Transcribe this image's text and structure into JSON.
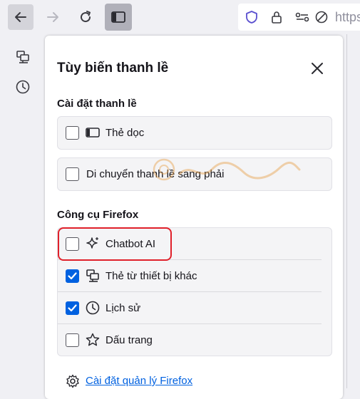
{
  "toolbar": {
    "back_icon": "arrow-left-icon",
    "forward_icon": "arrow-right-icon",
    "reload_icon": "reload-icon",
    "sidebar_icon": "sidebar-icon",
    "url_text": "https:"
  },
  "sidebar_strip": {
    "icons": [
      "synced-tabs-icon",
      "history-icon"
    ]
  },
  "panel": {
    "title": "Tùy biến thanh lề",
    "close_icon": "close-icon",
    "section1": {
      "heading": "Cài đặt thanh lề",
      "items": [
        {
          "label": "Thẻ dọc",
          "checked": false,
          "icon": "vertical-tabs-icon"
        },
        {
          "label": "Di chuyển thanh lề sang phải",
          "checked": false
        }
      ]
    },
    "section2": {
      "heading": "Công cụ Firefox",
      "items": [
        {
          "label": "Chatbot AI",
          "checked": false,
          "icon": "sparkle-icon"
        },
        {
          "label": "Thẻ từ thiết bị khác",
          "checked": true,
          "icon": "synced-tabs-icon"
        },
        {
          "label": "Lịch sử",
          "checked": true,
          "icon": "history-icon"
        },
        {
          "label": "Dấu trang",
          "checked": false,
          "icon": "star-icon"
        }
      ]
    },
    "footer": {
      "icon": "gear-icon",
      "link": "Cài đặt quản lý Firefox"
    }
  },
  "colors": {
    "accent": "#0061e0",
    "highlight": "#e0202a",
    "watermark": "#e8a24c"
  }
}
